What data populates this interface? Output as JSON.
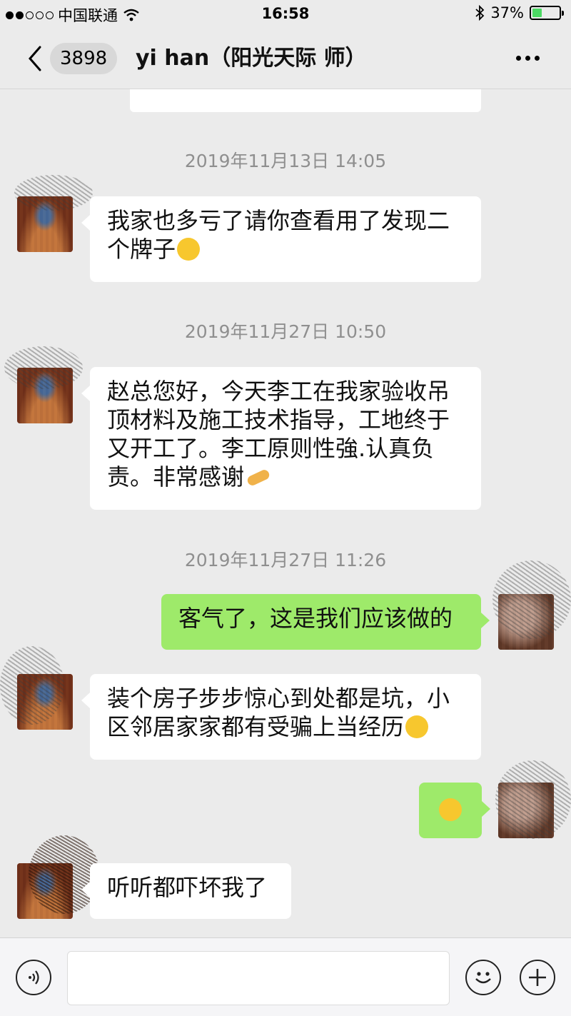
{
  "status_bar": {
    "carrier": "中国联通",
    "time": "16:58",
    "battery": "37%",
    "battery_level": 0.37,
    "icons": [
      "signal-dots-icon",
      "wifi-icon",
      "bluetooth-icon",
      "battery-icon"
    ]
  },
  "nav": {
    "unread_count": "3898",
    "title": "yi   han（阳光天际   师）",
    "icons": [
      "back-chevron-icon",
      "more-dots-icon"
    ]
  },
  "messages": [
    {
      "type": "timestamp",
      "text": "2019年11月13日 14:05"
    },
    {
      "type": "received",
      "line1": "我家也多亏了请你查看用了发现二",
      "line2": "个牌子",
      "emoji": "pleading-face-icon"
    },
    {
      "type": "timestamp",
      "text": "2019年11月27日 10:50"
    },
    {
      "type": "received",
      "line1": "赵总您好，今天李工在我家验收吊",
      "line2": "顶材料及施工技术指导，工地终于",
      "line3": "又开工了。李工原则性強.认真负",
      "line4": "责。非常感谢",
      "emoji": "ok-hand-icon"
    },
    {
      "type": "timestamp",
      "text": "2019年11月27日 11:26"
    },
    {
      "type": "sent",
      "line1": "客气了，这是我们应该做的"
    },
    {
      "type": "received",
      "line1": "装个房子步步惊心到处都是坑，小",
      "line2": "区邻居家家都有受骗上当经历",
      "emoji": "unamused-face-icon"
    },
    {
      "type": "sent",
      "emoji": "crying-laughing-face-icon"
    },
    {
      "type": "received",
      "line1": "听听都吓坏我了"
    }
  ],
  "input_bar": {
    "icons": [
      "voice-icon",
      "emoji-icon",
      "plus-icon"
    ],
    "text_value": ""
  },
  "colors": {
    "background": "#ebebeb",
    "sent_bubble": "#9eea6a",
    "received_bubble": "#ffffff",
    "timestamp": "#8f8f8f",
    "battery_fill": "#4cd964"
  }
}
